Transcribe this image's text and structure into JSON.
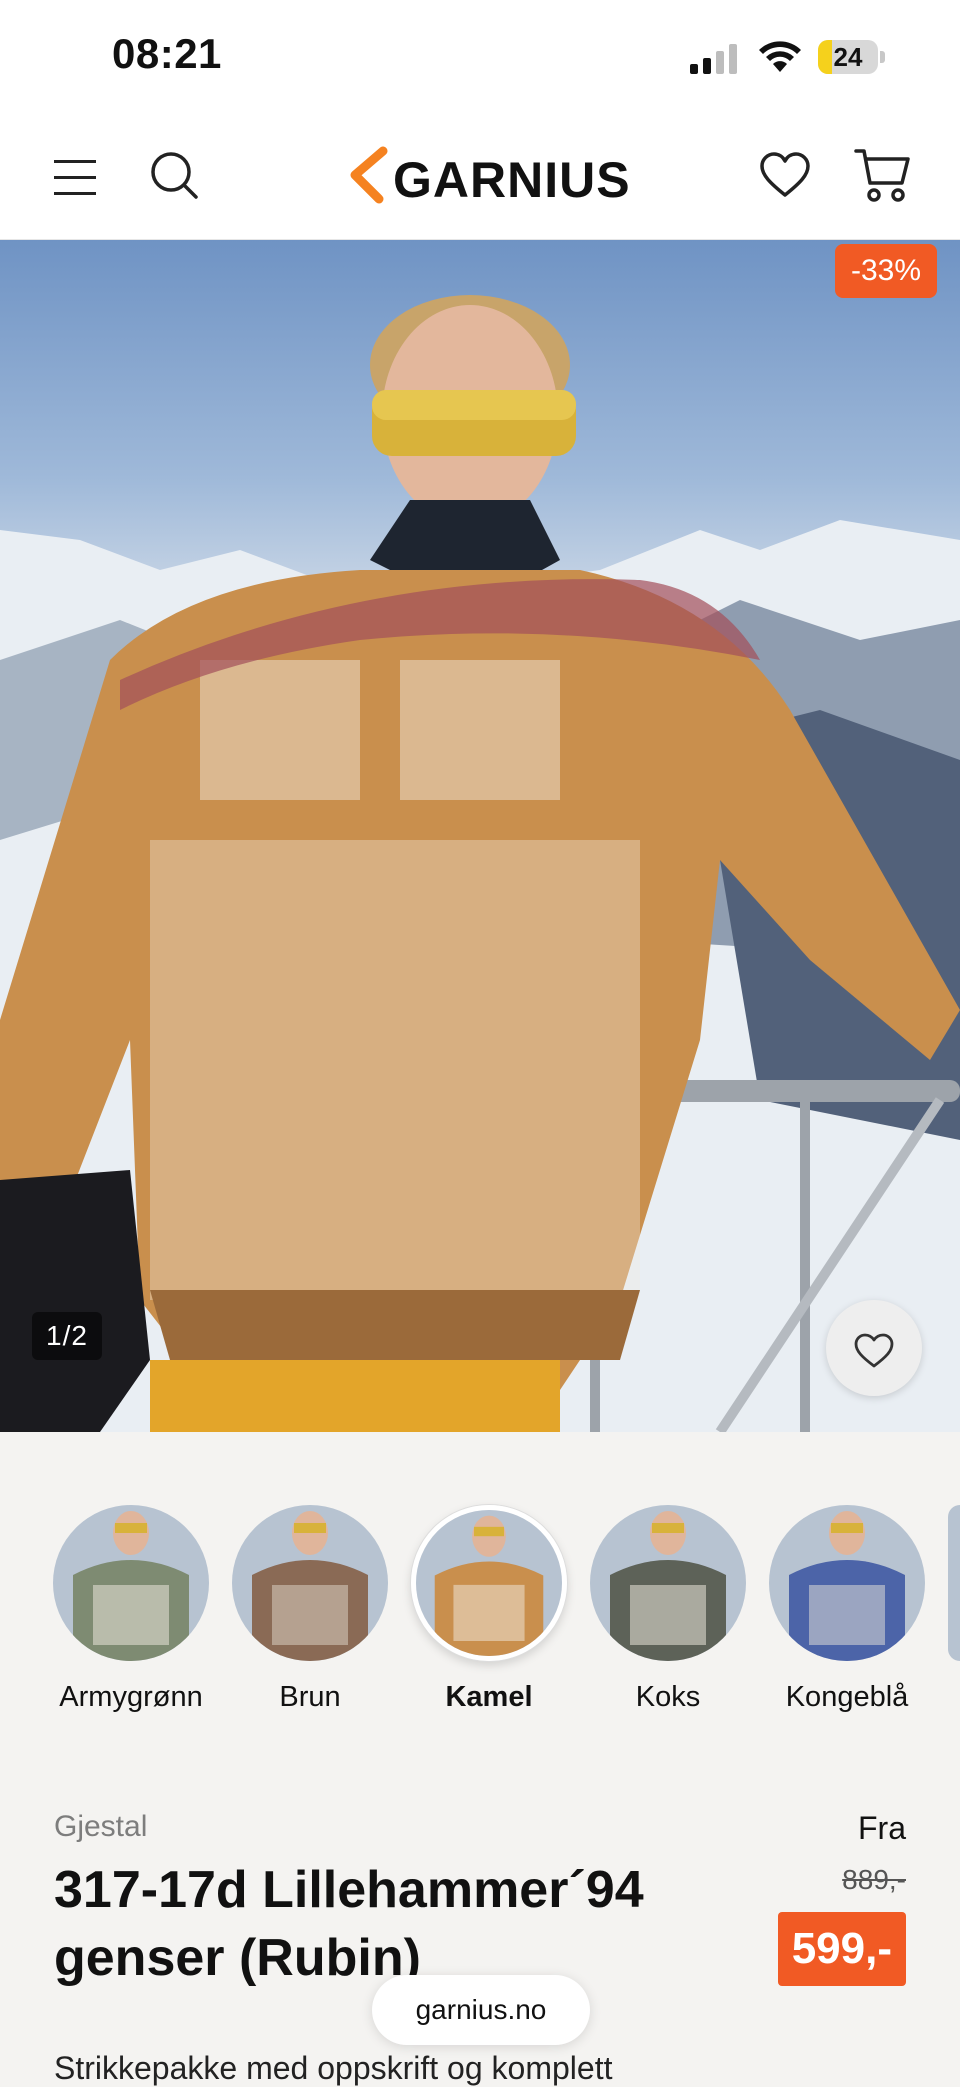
{
  "status_bar": {
    "time": "08:21",
    "battery": "24",
    "battery_level": 0.24
  },
  "header": {
    "logo_text": "GARNIUS",
    "icons": [
      "menu-icon",
      "search-icon",
      "heart-icon",
      "cart-icon"
    ]
  },
  "hero": {
    "discount": "-33%",
    "pager": "1/2"
  },
  "swatches": [
    {
      "label": "Armygrønn",
      "selected": false
    },
    {
      "label": "Brun",
      "selected": false
    },
    {
      "label": "Kamel",
      "selected": true
    },
    {
      "label": "Koks",
      "selected": false
    },
    {
      "label": "Kongeblå",
      "selected": false
    }
  ],
  "product": {
    "brand": "Gjestal",
    "title": "317-17d Lillehammer´94 genser (Rubin)",
    "price_prefix": "Fra",
    "old_price": "889,-",
    "price": "599,-",
    "description": "Strikkepakke med oppskrift og komplett"
  },
  "browser": {
    "url": "garnius.no"
  },
  "colors": {
    "accent": "#f15a24",
    "background": "#f4f3f1"
  }
}
